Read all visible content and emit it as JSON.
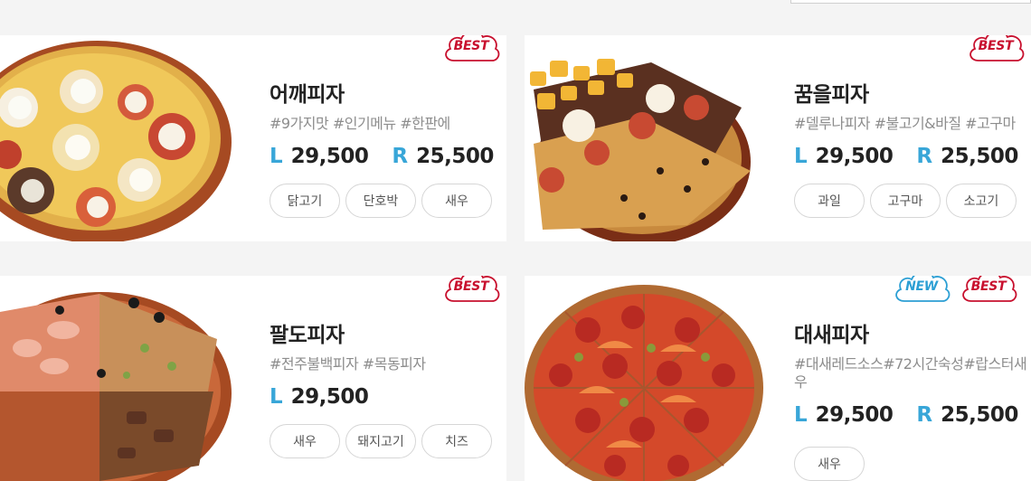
{
  "cards": [
    {
      "name": "어깨피자",
      "tags": "#9가지맛 #인기메뉴 #한판에",
      "price_l_size": "L",
      "price_l": "29,500",
      "price_r_size": "R",
      "price_r": "25,500",
      "toppings": [
        "닭고기",
        "단호박",
        "새우"
      ],
      "badges": [
        "BEST"
      ]
    },
    {
      "name": "꿈을피자",
      "tags": "#델루나피자 #불고기&바질 #고구마",
      "price_l_size": "L",
      "price_l": "29,500",
      "price_r_size": "R",
      "price_r": "25,500",
      "toppings": [
        "과일",
        "고구마",
        "소고기"
      ],
      "badges": [
        "BEST"
      ]
    },
    {
      "name": "팔도피자",
      "tags": "#전주불백피자 #목동피자",
      "price_l_size": "L",
      "price_l": "29,500",
      "toppings": [
        "새우",
        "돼지고기",
        "치즈"
      ],
      "badges": [
        "BEST"
      ]
    },
    {
      "name": "대새피자",
      "tags": "#대새레드소스#72시간숙성#랍스터새우",
      "price_l_size": "L",
      "price_l": "29,500",
      "price_r_size": "R",
      "price_r": "25,500",
      "toppings": [
        "새우"
      ],
      "badges": [
        "NEW",
        "BEST"
      ]
    }
  ],
  "colors": {
    "best": "#c8102e",
    "new": "#2c9fd4",
    "size_label": "#38a6d8"
  }
}
